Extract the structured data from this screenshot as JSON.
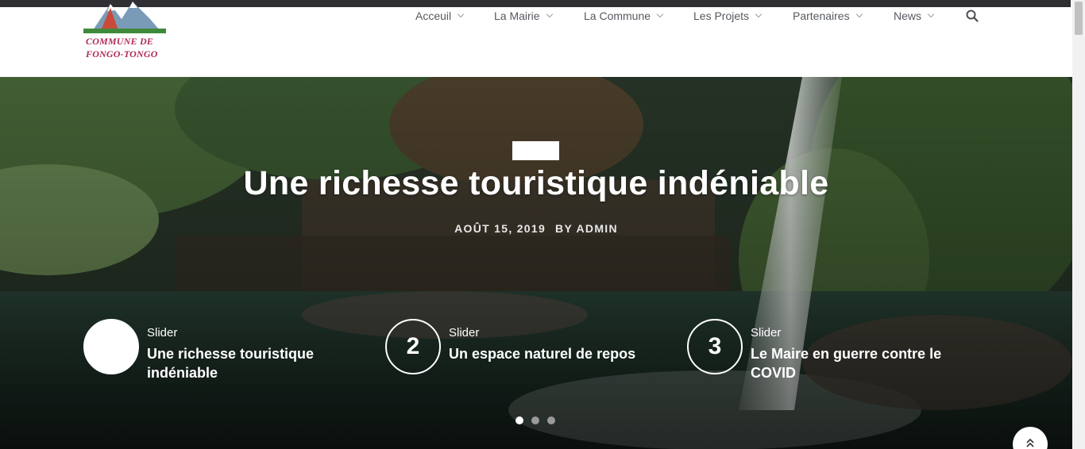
{
  "logo": {
    "line1": "COMMUNE DE",
    "line2": "FONGO-TONGO"
  },
  "nav": {
    "items": [
      {
        "label": "Acceuil"
      },
      {
        "label": "La Mairie"
      },
      {
        "label": "La Commune"
      },
      {
        "label": "Les Projets"
      },
      {
        "label": "Partenaires"
      },
      {
        "label": "News"
      }
    ]
  },
  "hero": {
    "title": "Une richesse touristique indéniable",
    "date": "AOÛT 15, 2019",
    "author": "BY ADMIN"
  },
  "slides": [
    {
      "number": "",
      "category": "Slider",
      "title": "Une richesse touristique indéniable"
    },
    {
      "number": "2",
      "category": "Slider",
      "title": "Un espace naturel de repos"
    },
    {
      "number": "3",
      "category": "Slider",
      "title": "Le Maire en guerre contre le COVID"
    }
  ],
  "pagination": {
    "count": 3,
    "active_index": 0
  },
  "icons": {
    "search": "search-icon",
    "chevron": "chevron-down-icon",
    "back_to_top": "double-chevron-up-icon"
  }
}
